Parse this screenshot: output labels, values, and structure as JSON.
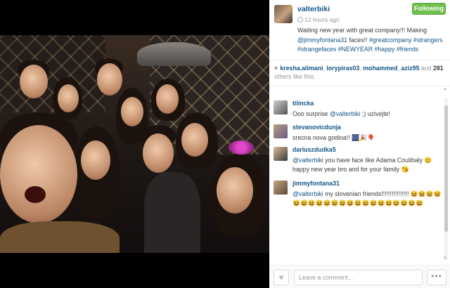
{
  "post": {
    "username": "valterbiki",
    "time": "12 hours ago",
    "follow_label": "Following",
    "caption_part1": "Waiting new year with great company!!! Making ",
    "caption_mention": "@jimmyfontana31",
    "caption_part2": " faces!! ",
    "caption_tags": "#greatcompany #strangers #strangefaces #NEWYEAR #happy #friends"
  },
  "likes": {
    "likers": [
      "kresha.alimani",
      "lorypiras03",
      "mohammed_aziz95"
    ],
    "and_label": " and ",
    "count": "281",
    "others_label": " others like this."
  },
  "comments": [
    {
      "user": "tiiincka",
      "mention": "",
      "text": "Ooo surprise ",
      "mention_inline": "@valterbiki",
      "text_after": " ;) uzivejte!"
    },
    {
      "user": "stevanovicdunja",
      "mention": "",
      "text": "srecna nova godina!! 🎆🎉🎈",
      "mention_inline": "",
      "text_after": ""
    },
    {
      "user": "dariuszdudka5",
      "mention": "",
      "text": "",
      "mention_inline": "@valterbiki",
      "text_after": " you have face like Adama Coulibaly 😊happy new year bro and for your family 😘"
    },
    {
      "user": "jimmyfontana31",
      "mention": "",
      "text": "",
      "mention_inline": "@valterbiki",
      "text_after": " my slovenian friends!!!!!!!!!!!!!!!! 😆😆😆😆😆😆😆😆😆😆😆😆😆😆😆😆😆😆😆😆😆"
    }
  ],
  "footer": {
    "comment_placeholder": "Leave a comment...",
    "more_label": "•••"
  },
  "icons": {
    "like": "heart-icon",
    "clock": "clock-icon",
    "more": "more-icon"
  },
  "colors": {
    "link": "#125688",
    "follow_bg": "#70c050"
  }
}
